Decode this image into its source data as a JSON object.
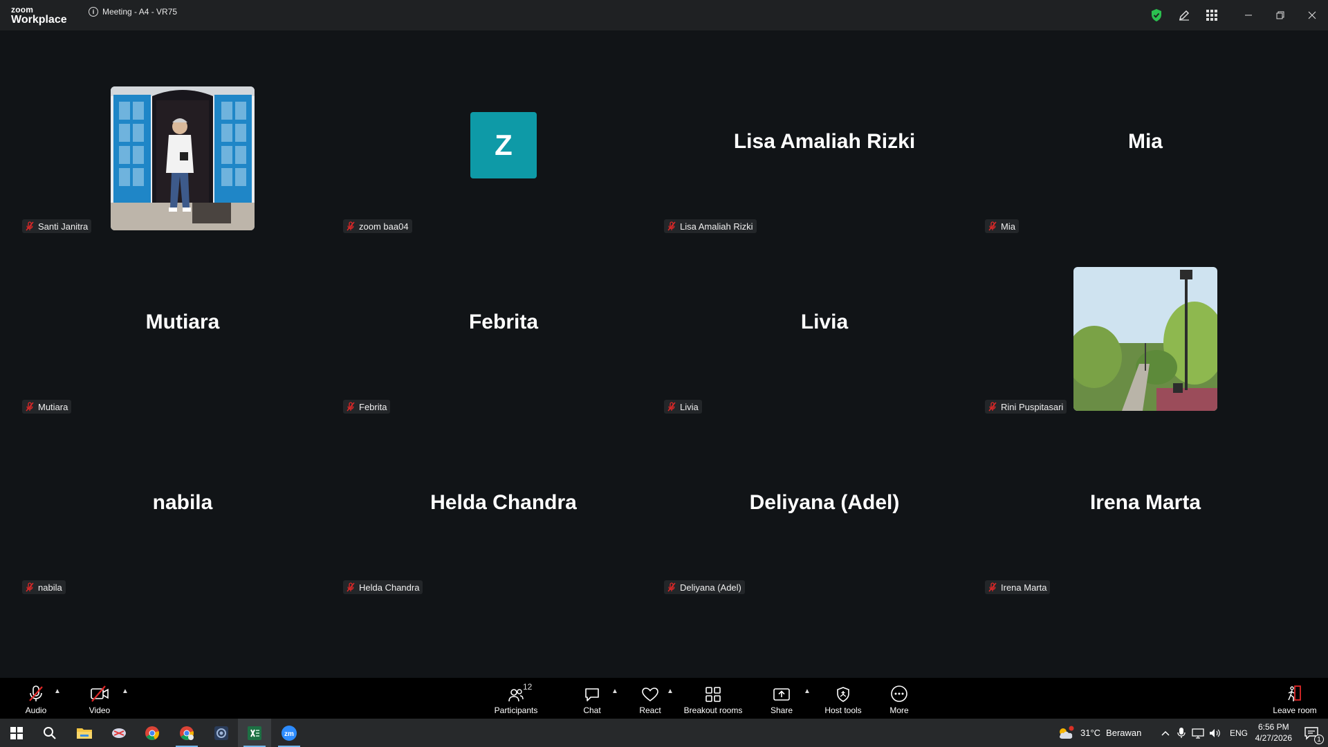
{
  "app": {
    "logo_top": "zoom",
    "logo_bottom": "Workplace",
    "meeting_title": "Meeting - A4 - VR75"
  },
  "participants": [
    {
      "display": "photo-person",
      "tag": "Santi Janitra"
    },
    {
      "display": "letter",
      "letter": "Z",
      "tag": "zoom baa04"
    },
    {
      "display": "name",
      "big_name": "Lisa Amaliah Rizki",
      "tag": "Lisa Amaliah Rizki"
    },
    {
      "display": "name",
      "big_name": "Mia",
      "tag": "Mia"
    },
    {
      "display": "name",
      "big_name": "Mutiara",
      "tag": "Mutiara"
    },
    {
      "display": "name",
      "big_name": "Febrita",
      "tag": "Febrita"
    },
    {
      "display": "name",
      "big_name": "Livia",
      "tag": "Livia"
    },
    {
      "display": "photo-park",
      "tag": "Rini Puspitasari"
    },
    {
      "display": "name",
      "big_name": "nabila",
      "tag": "nabila"
    },
    {
      "display": "name",
      "big_name": "Helda Chandra",
      "tag": "Helda Chandra"
    },
    {
      "display": "name",
      "big_name": "Deliyana (Adel)",
      "tag": "Deliyana (Adel)"
    },
    {
      "display": "name",
      "big_name": "Irena Marta",
      "tag": "Irena Marta"
    }
  ],
  "toolbar": {
    "audio": "Audio",
    "video": "Video",
    "participants": "Participants",
    "participants_count": "12",
    "chat": "Chat",
    "react": "React",
    "breakout": "Breakout rooms",
    "share": "Share",
    "host_tools": "Host tools",
    "more": "More",
    "leave": "Leave room"
  },
  "taskbar": {
    "weather_temp": "31°C",
    "weather_desc": "Berawan",
    "language": "ENG",
    "time": "6:56 PM",
    "date": "4/27/2026",
    "notification_count": "1"
  },
  "colors": {
    "background": "#111417",
    "titlebar": "#1f2123",
    "avatar_teal": "#0e9aa7",
    "muted_red": "#e02828",
    "shield_green": "#2bc04f"
  }
}
